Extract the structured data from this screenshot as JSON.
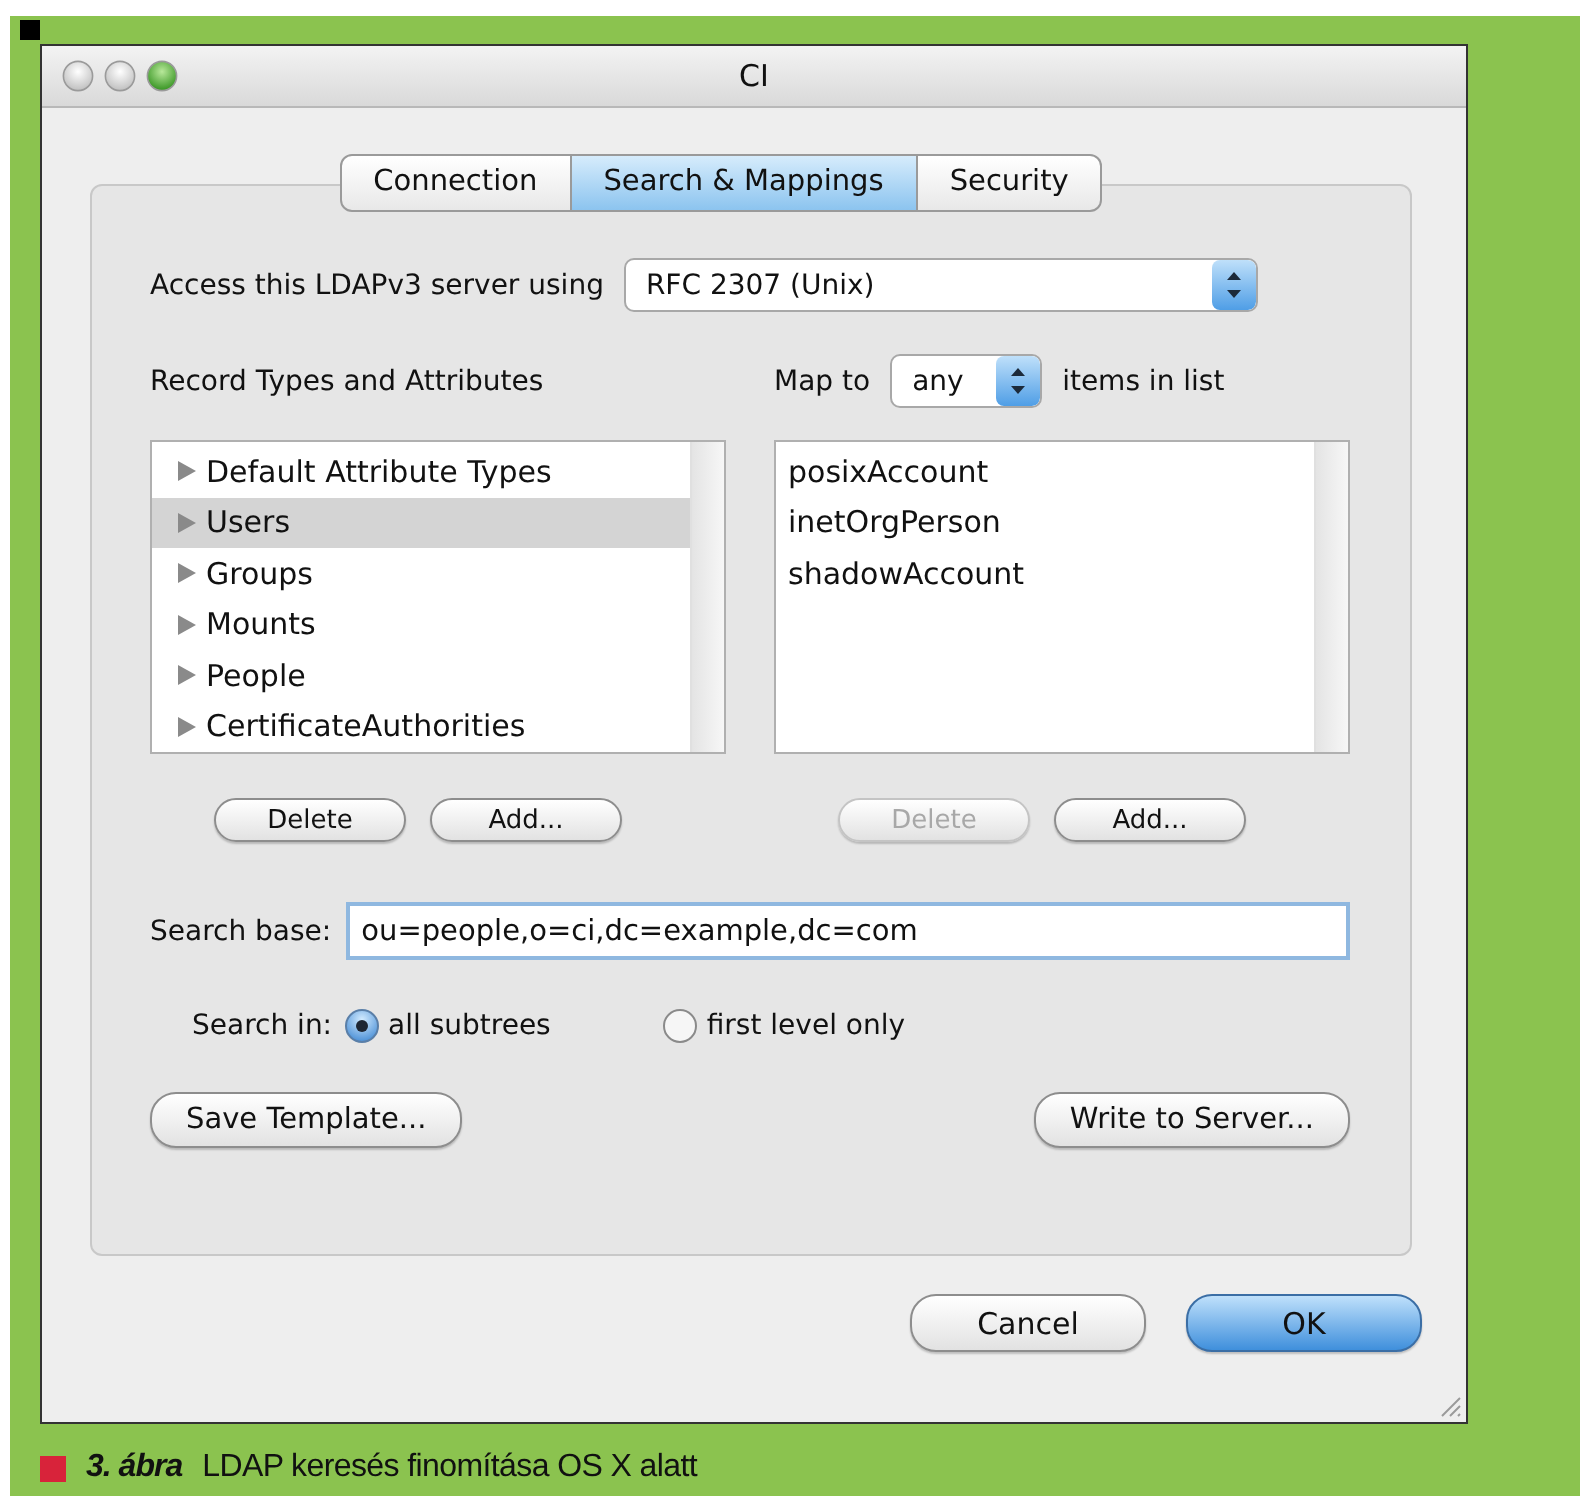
{
  "window": {
    "title": "CI",
    "controls": [
      {
        "active": false
      },
      {
        "active": false
      },
      {
        "active": true
      }
    ]
  },
  "tabs": [
    {
      "label": "Connection",
      "selected": false
    },
    {
      "label": "Search & Mappings",
      "selected": true
    },
    {
      "label": "Security",
      "selected": false
    }
  ],
  "access": {
    "label": "Access this LDAPv3 server using",
    "value": "RFC 2307 (Unix)"
  },
  "record_types": {
    "label": "Record Types and Attributes",
    "items": [
      {
        "label": "Default Attribute Types",
        "selected": false,
        "expanded": false
      },
      {
        "label": "Users",
        "selected": true,
        "expanded": false
      },
      {
        "label": "Groups",
        "selected": false,
        "expanded": false
      },
      {
        "label": "Mounts",
        "selected": false,
        "expanded": false
      },
      {
        "label": "People",
        "selected": false,
        "expanded": false
      },
      {
        "label": "CertificateAuthorities",
        "selected": false,
        "expanded": false
      }
    ],
    "buttons": [
      {
        "label": "Delete",
        "disabled": false
      },
      {
        "label": "Add...",
        "disabled": false
      }
    ]
  },
  "mapping": {
    "prefix": "Map to",
    "value": "any",
    "suffix": "items in list",
    "items": [
      "posixAccount",
      "inetOrgPerson",
      "shadowAccount"
    ],
    "buttons": [
      {
        "label": "Delete",
        "disabled": true
      },
      {
        "label": "Add...",
        "disabled": false
      }
    ]
  },
  "search_base": {
    "label": "Search base:",
    "value": "ou=people,o=ci,dc=example,dc=com"
  },
  "search_in": {
    "label": "Search in:",
    "options": [
      {
        "label": "all subtrees",
        "selected": true
      },
      {
        "label": "first level only",
        "selected": false
      }
    ]
  },
  "actions": [
    {
      "label": "Save Template..."
    },
    {
      "label": "Write to Server..."
    }
  ],
  "buttons": [
    {
      "label": "Cancel",
      "default": false
    },
    {
      "label": "OK",
      "default": true
    }
  ],
  "caption": {
    "figure": "3. ábra",
    "text": "LDAP keresés finomítása OS X alatt"
  }
}
